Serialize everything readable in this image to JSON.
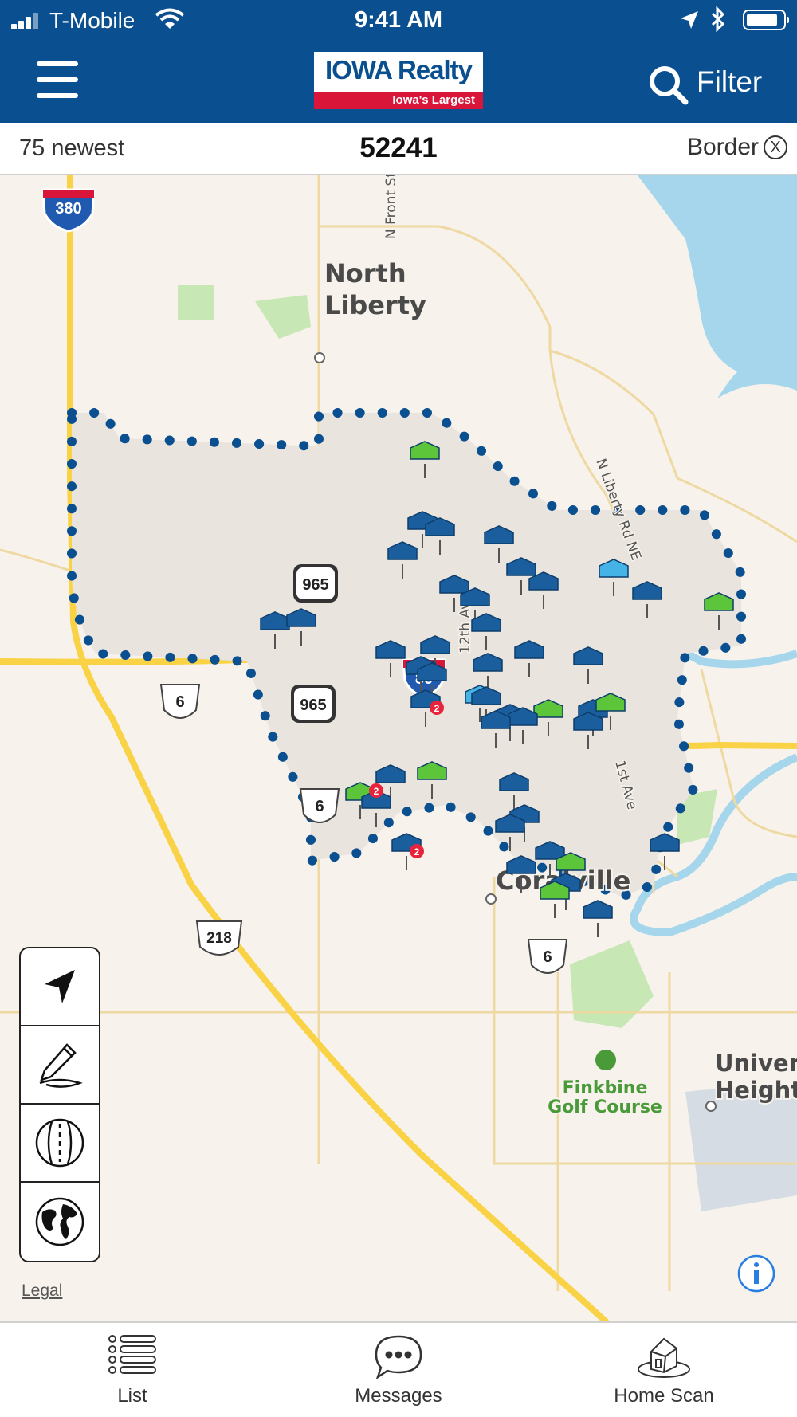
{
  "status_bar": {
    "carrier": "T-Mobile",
    "time": "9:41 AM"
  },
  "header": {
    "logo_text": "IOWA Realty",
    "logo_tagline": "Iowa's Largest",
    "filter_label": "Filter"
  },
  "subbar": {
    "listing_count": "75 newest",
    "zip_code": "52241",
    "border_label": "Border",
    "border_close": "X"
  },
  "map": {
    "place_labels": [
      "North",
      "Liberty",
      "Coralville",
      "Finkbine",
      "Golf Course",
      "Univers",
      "Height"
    ],
    "street_labels": [
      "N Front St",
      "N Liberty Rd NE",
      "12th Ave",
      "1st Ave"
    ],
    "shields": {
      "i380": "380",
      "i80": "80",
      "ia965_a": "965",
      "ia965_b": "965",
      "us6_a": "6",
      "us6_b": "6",
      "us6_c": "6",
      "us218": "218"
    },
    "cluster_badge": "2",
    "colors": {
      "listing_pin": "#1b5e9e",
      "new_pin": "#5cc53a",
      "open_house_pin": "#45b3e6",
      "boundary": "#0a4f8f",
      "freeway": "#f9d246",
      "water": "#a6d6ec",
      "park": "#c7e7b4"
    }
  },
  "tools": [
    "location-arrow-icon",
    "draw-pencil-icon",
    "commute-road-icon",
    "globe-icon"
  ],
  "legal_label": "Legal",
  "tabs": [
    {
      "label": "List"
    },
    {
      "label": "Messages"
    },
    {
      "label": "Home Scan"
    }
  ]
}
